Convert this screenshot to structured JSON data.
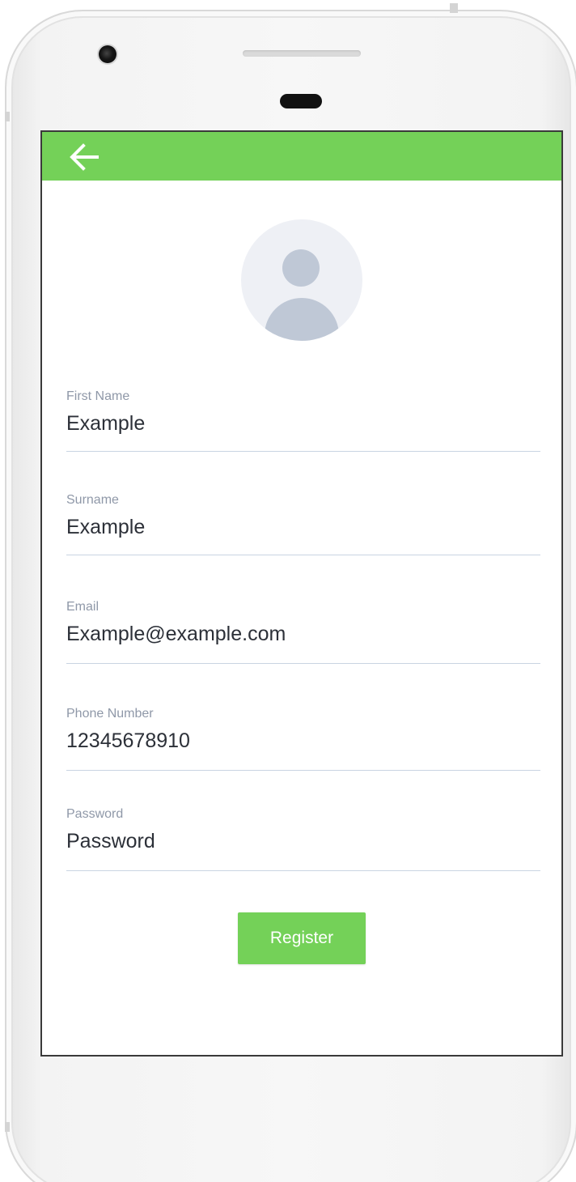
{
  "colors": {
    "accent": "#74d158",
    "label": "#8f98a8",
    "value": "#2c3038",
    "divider": "#c9d4e2",
    "avatar_bg": "#eef0f5",
    "avatar_fg": "#bfc8d6"
  },
  "appbar": {
    "back_icon": "arrow-left-icon"
  },
  "avatar": {
    "icon": "user-avatar-icon"
  },
  "form": {
    "fields": [
      {
        "label": "First Name",
        "value": "Example"
      },
      {
        "label": "Surname",
        "value": "Example"
      },
      {
        "label": "Email",
        "value": "Example@example.com"
      },
      {
        "label": "Phone Number",
        "value": "12345678910"
      },
      {
        "label": "Password",
        "value": "Password"
      }
    ],
    "register_label": "Register"
  }
}
